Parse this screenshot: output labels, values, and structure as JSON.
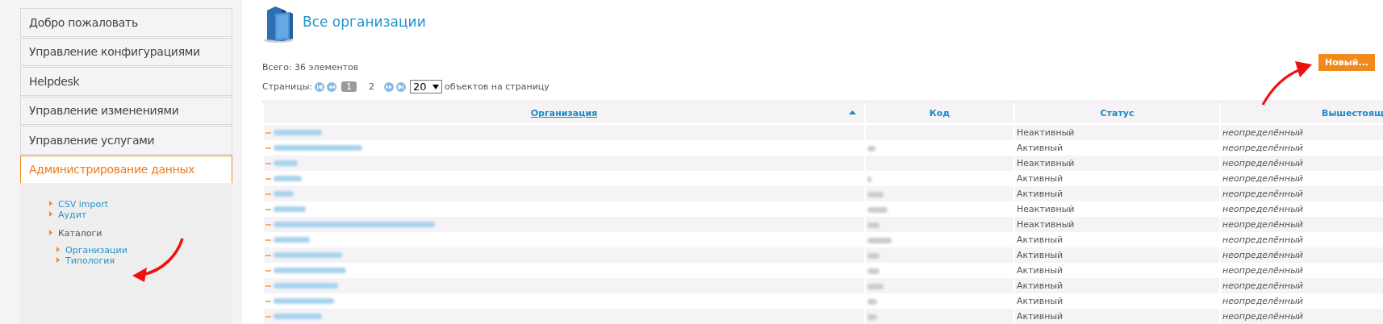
{
  "sidebar": {
    "items": [
      {
        "label": "Добро пожаловать",
        "selected": false
      },
      {
        "label": "Управление конфигурациями",
        "selected": false
      },
      {
        "label": "Helpdesk",
        "selected": false
      },
      {
        "label": "Управление изменениями",
        "selected": false
      },
      {
        "label": "Управление услугами",
        "selected": false
      },
      {
        "label": "Администрирование данных",
        "selected": true,
        "children": [
          {
            "label": "CSV import",
            "kind": "link"
          },
          {
            "label": "Аудит",
            "kind": "link"
          },
          {
            "label": "Каталоги",
            "kind": "group",
            "children": [
              {
                "label": "Организации"
              },
              {
                "label": "Типология"
              }
            ]
          }
        ]
      }
    ]
  },
  "page": {
    "title": "Все организации",
    "total": "Всего: 36 элементов",
    "new_button": "Новый..."
  },
  "pagination": {
    "label": "Страницы:",
    "pages": [
      {
        "label": "1",
        "selected": true
      },
      {
        "label": "2",
        "selected": false
      }
    ],
    "per_page": "20",
    "per_page_suffix": "объектов на страницу"
  },
  "table": {
    "columns": [
      {
        "label": "Организация",
        "sorted_ascending": true
      },
      {
        "label": "Код"
      },
      {
        "label": "Статус"
      },
      {
        "label": "Вышестоящ"
      }
    ],
    "rows": [
      {
        "status": "Неактивный",
        "parent": "неопределённый"
      },
      {
        "status": "Активный",
        "parent": "неопределённый"
      },
      {
        "status": "Неактивный",
        "parent": "неопределённый"
      },
      {
        "status": "Активный",
        "parent": "неопределённый"
      },
      {
        "status": "Активный",
        "parent": "неопределённый"
      },
      {
        "status": "Неактивный",
        "parent": "неопределённый"
      },
      {
        "status": "Неактивный",
        "parent": "неопределённый"
      },
      {
        "status": "Активный",
        "parent": "неопределённый"
      },
      {
        "status": "Активный",
        "parent": "неопределённый"
      },
      {
        "status": "Активный",
        "parent": "неопределённый"
      },
      {
        "status": "Активный",
        "parent": "неопределённый"
      },
      {
        "status": "Активный",
        "parent": "неопределённый"
      },
      {
        "status": "Активный",
        "parent": "неопределённый"
      }
    ]
  }
}
